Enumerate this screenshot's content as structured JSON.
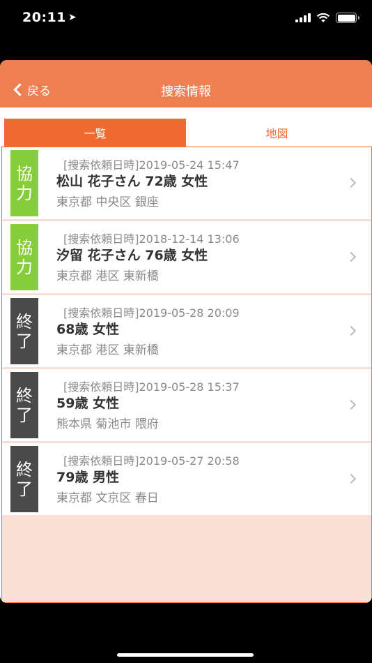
{
  "status_bar": {
    "time": "20:11",
    "location_arrow": "➤"
  },
  "nav": {
    "back_label": "戻る",
    "title": "捜索情報"
  },
  "tabs": [
    {
      "label": "一覧",
      "active": true
    },
    {
      "label": "地図",
      "active": false
    }
  ],
  "list": [
    {
      "status": [
        "協",
        "力"
      ],
      "status_color": "#86cd3c",
      "date": "[捜索依頼日時]2019-05-24 15:47",
      "name": "松山 花子さん 72歳 女性",
      "address": "東京都 中央区 銀座"
    },
    {
      "status": [
        "協",
        "力"
      ],
      "status_color": "#86cd3c",
      "date": "[捜索依頼日時]2018-12-14 13:06",
      "name": "汐留 花子さん 76歳 女性",
      "address": "東京都 港区 東新橋"
    },
    {
      "status": [
        "終",
        "了"
      ],
      "status_color": "#4a4a4a",
      "date": "[捜索依頼日時]2019-05-28 20:09",
      "name": "68歳 女性",
      "address": "東京都 港区 東新橋"
    },
    {
      "status": [
        "終",
        "了"
      ],
      "status_color": "#4a4a4a",
      "date": "[捜索依頼日時]2019-05-28 15:37",
      "name": "59歳 女性",
      "address": "熊本県 菊池市 隈府"
    },
    {
      "status": [
        "終",
        "了"
      ],
      "status_color": "#4a4a4a",
      "date": "[捜索依頼日時]2019-05-27 20:58",
      "name": "79歳 男性",
      "address": "東京都 文京区 春日"
    }
  ],
  "colors": {
    "accent": "#ef6b33",
    "nav_background": "#ee7f50",
    "list_background": "#fae0d5"
  }
}
